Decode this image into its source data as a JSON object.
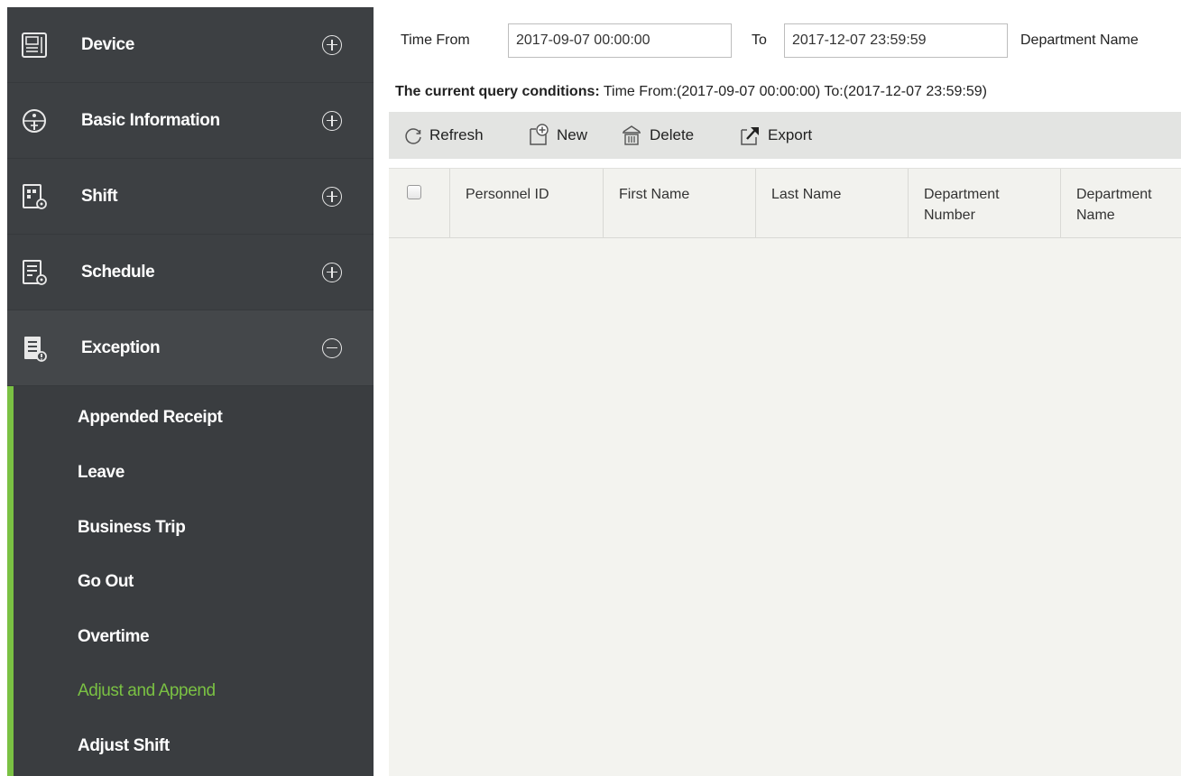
{
  "sidebar": {
    "menu": [
      {
        "label": "Device",
        "icon": "device-icon",
        "state": "collapsed"
      },
      {
        "label": "Basic Information",
        "icon": "basic-information-icon",
        "state": "collapsed"
      },
      {
        "label": "Shift",
        "icon": "shift-icon",
        "state": "collapsed"
      },
      {
        "label": "Schedule",
        "icon": "schedule-icon",
        "state": "collapsed"
      },
      {
        "label": "Exception",
        "icon": "exception-icon",
        "state": "expanded"
      }
    ],
    "submenu": [
      {
        "label": "Appended Receipt"
      },
      {
        "label": "Leave"
      },
      {
        "label": "Business Trip"
      },
      {
        "label": "Go Out"
      },
      {
        "label": "Overtime"
      },
      {
        "label": "Adjust and Append",
        "active": true
      },
      {
        "label": "Adjust Shift"
      }
    ]
  },
  "filter": {
    "time_from_label": "Time From",
    "time_from_value": "2017-09-07 00:00:00",
    "to_label": "To",
    "to_value": "2017-12-07 23:59:59",
    "department_name_label": "Department Name"
  },
  "conditions": {
    "label": "The current query conditions:",
    "text": "Time From:(2017-09-07 00:00:00)  To:(2017-12-07 23:59:59)"
  },
  "toolbar": {
    "refresh_label": "Refresh",
    "new_label": "New",
    "delete_label": "Delete",
    "export_label": "Export"
  },
  "table": {
    "columns": [
      "Personnel ID",
      "First Name",
      "Last Name",
      [
        "Department",
        "Number"
      ],
      [
        "Department",
        "Name"
      ]
    ],
    "rows": []
  },
  "colors": {
    "sidebar_bg": "#3d4043",
    "accent_green": "#7ac143",
    "toolbar_bg": "#e3e4e2",
    "grid_bg": "#f3f3ef"
  }
}
